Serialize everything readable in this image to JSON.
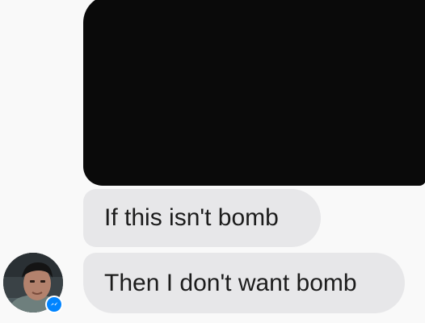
{
  "conversation": {
    "messages": [
      {
        "type": "image",
        "content": "blacked-out-media",
        "color": "#0a0a0a"
      },
      {
        "type": "text",
        "text": "If this isn't bomb"
      },
      {
        "type": "text",
        "text": "Then I don't want bomb"
      }
    ],
    "sender": {
      "avatar": "profile-photo",
      "badge_icon": "messenger-icon",
      "badge_color": "#0084ff"
    }
  },
  "theme": {
    "background": "#f9f9f9",
    "bubble_color": "#e7e7e9",
    "text_color": "#1c1c1c"
  }
}
